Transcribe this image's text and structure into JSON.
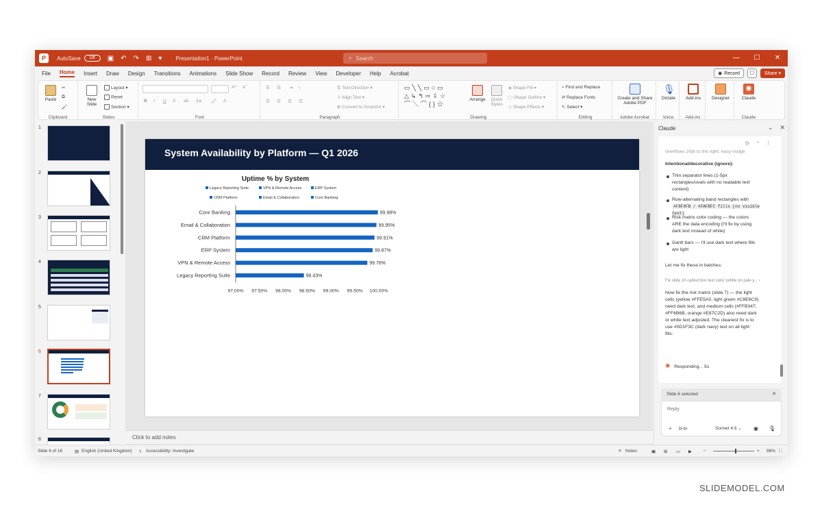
{
  "titlebar": {
    "autosave": "AutoSave",
    "toggle": "Off",
    "doc_title": "Presentation1 · PowerPoint",
    "search_placeholder": "Search"
  },
  "tabs": [
    "File",
    "Home",
    "Insert",
    "Draw",
    "Design",
    "Transitions",
    "Animations",
    "Slide Show",
    "Record",
    "Review",
    "View",
    "Developer",
    "Help",
    "Acrobat"
  ],
  "active_tab": "Home",
  "tab_actions": {
    "record": "Record",
    "share": "Share"
  },
  "ribbon": {
    "clipboard": {
      "label": "Clipboard",
      "paste": "Paste"
    },
    "slides": {
      "label": "Slides",
      "new_slide": "New Slide",
      "layout": "Layout",
      "reset": "Reset",
      "section": "Section"
    },
    "font": {
      "label": "Font"
    },
    "paragraph": {
      "label": "Paragraph",
      "text_direction": "Text Direction",
      "align_text": "Align Text",
      "convert_smartart": "Convert to SmartArt"
    },
    "drawing": {
      "label": "Drawing",
      "arrange": "Arrange",
      "quick_styles": "Quick Styles",
      "shape_fill": "Shape Fill",
      "shape_outline": "Shape Outline",
      "shape_effects": "Shape Effects"
    },
    "editing": {
      "label": "Editing",
      "find_replace": "Find and Replace",
      "replace_fonts": "Replace Fonts",
      "select": "Select"
    },
    "acrobat": {
      "label": "Adobe Acrobat",
      "create_share": "Create and Share Adobe PDF"
    },
    "voice": {
      "label": "Voice",
      "dictate": "Dictate"
    },
    "addins": {
      "label": "Add-ins",
      "addins": "Add-ins"
    },
    "designer": {
      "designer": "Designer"
    },
    "claude": {
      "label": "Claude",
      "claude": "Claude"
    }
  },
  "thumbnails": [
    {
      "num": "1"
    },
    {
      "num": "2"
    },
    {
      "num": "3"
    },
    {
      "num": "4"
    },
    {
      "num": "5"
    },
    {
      "num": "6"
    },
    {
      "num": "7"
    },
    {
      "num": "8"
    }
  ],
  "selected_slide_index": 5,
  "slide": {
    "title": "System Availability by Platform — Q1 2026"
  },
  "chart_data": {
    "type": "bar",
    "orientation": "horizontal",
    "title": "Uptime % by System",
    "categories": [
      "Core Banking",
      "Email & Collaboration",
      "CRM Platform",
      "ERP System",
      "VPN & Remote Access",
      "Legacy Reporting Suite"
    ],
    "values": [
      99.98,
      99.95,
      99.91,
      99.87,
      99.76,
      98.43
    ],
    "data_labels": [
      "99.98%",
      "99.95%",
      "99.91%",
      "99.87%",
      "99.76%",
      "98.43%"
    ],
    "xlim": [
      97.0,
      100.0
    ],
    "x_ticks": [
      "97.00%",
      "97.50%",
      "98.00%",
      "98.50%",
      "99.00%",
      "99.50%",
      "100.00%"
    ],
    "legend": [
      "Legacy Reporting Suite",
      "VPN & Remote Access",
      "ERP System",
      "CRM Platform",
      "Email & Collaboration",
      "Core Banking"
    ],
    "legend_position": "top",
    "bar_color": "#1565c0",
    "grid": false
  },
  "notes_placeholder": "Click to add notes",
  "claude_pane": {
    "title": "Claude",
    "chat": {
      "partial_top": "overflows 20pt to the right; easy nudge",
      "heading": "Intentional/decorative (ignore):",
      "bullets": [
        [
          "Thin separator lines (1-5px",
          "rectangles/ovals with no readable text",
          "content)"
        ],
        [
          "Row-alternating band rectangles with",
          "#F8F9FB / #FAFBFC fills (no visible text)"
        ],
        [
          "Risk matrix color coding — the colors",
          "ARE the data encoding (I'll fix by using",
          "dark text instead of white)"
        ],
        [
          "Gantt bars — I'll use dark text where fills",
          "are light"
        ]
      ],
      "batch_line": "Let me fix these in batches:",
      "tool_line": "Fix slide 10 callout box text color (white on pale y...",
      "para": [
        "Now fix the risk matrix (slide 7) — the light",
        "cells (yellow #FFE5A0, light green #C8E6C9)",
        "need dark text, and medium cells (#FFB347,",
        "#FF6B6B, orange #E87C2D) also need dark",
        "or white text adjusted. The cleanest fix is to",
        "use #0D1F3C (dark navy) text on all light",
        "fills:"
      ],
      "responding": "Responding... 5s"
    },
    "selected_chip": "Slide 6 selected",
    "reply_placeholder": "Reply",
    "model": "Sonnet 4.6"
  },
  "status": {
    "slide_count": "Slide 6 of 16",
    "language": "English (United Kingdom)",
    "accessibility": "Accessibility: Investigate",
    "notes": "Notes",
    "zoom": "98%"
  },
  "watermark": "SLIDEMODEL.COM",
  "colors": {
    "accent": "#c43e1c",
    "navy": "#0f1f3d",
    "bar": "#1565c0"
  }
}
